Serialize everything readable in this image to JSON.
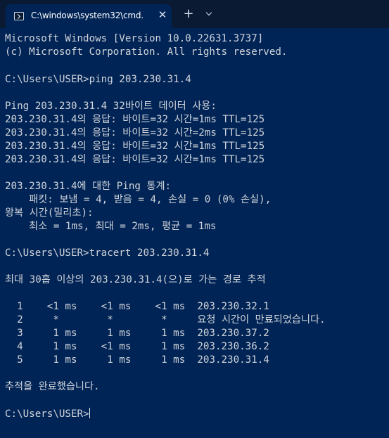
{
  "window": {
    "tab_title": "C:\\windows\\system32\\cmd.",
    "close_glyph": "✕",
    "new_tab_glyph": "+"
  },
  "terminal": {
    "lines": [
      "Microsoft Windows [Version 10.0.22631.3737]",
      "(c) Microsoft Corporation. All rights reserved.",
      "",
      "C:\\Users\\USER>ping 203.230.31.4",
      "",
      "Ping 203.230.31.4 32바이트 데이터 사용:",
      "203.230.31.4의 응답: 바이트=32 시간=1ms TTL=125",
      "203.230.31.4의 응답: 바이트=32 시간=2ms TTL=125",
      "203.230.31.4의 응답: 바이트=32 시간=1ms TTL=125",
      "203.230.31.4의 응답: 바이트=32 시간=1ms TTL=125",
      "",
      "203.230.31.4에 대한 Ping 통계:",
      "    패킷: 보냄 = 4, 받음 = 4, 손실 = 0 (0% 손실),",
      "왕복 시간(밀리초):",
      "    최소 = 1ms, 최대 = 2ms, 평균 = 1ms",
      "",
      "C:\\Users\\USER>tracert 203.230.31.4",
      "",
      "최대 30홉 이상의 203.230.31.4(으)로 가는 경로 추적",
      "",
      "  1    <1 ms    <1 ms    <1 ms  203.230.32.1",
      "  2     *        *        *     요청 시간이 만료되었습니다.",
      "  3     1 ms     1 ms     1 ms  203.230.37.2",
      "  4     1 ms    <1 ms     1 ms  203.230.36.2",
      "  5     1 ms     1 ms     1 ms  203.230.31.4",
      "",
      "추적을 완료했습니다.",
      "",
      "C:\\Users\\USER>"
    ]
  }
}
